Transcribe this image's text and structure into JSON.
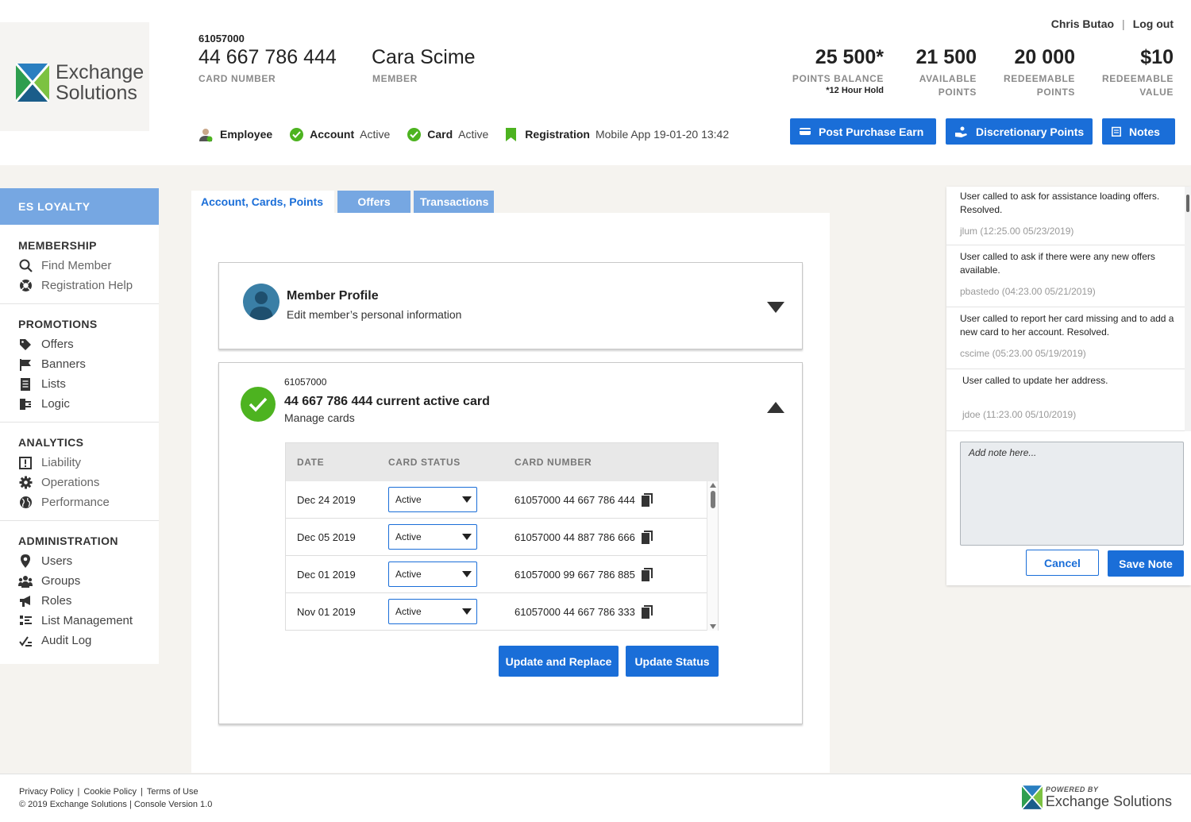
{
  "brand": {
    "line1": "Exchange",
    "line2": "Solutions"
  },
  "header": {
    "card_prefix": "61057000",
    "card_number": "44 667 786 444",
    "card_label": "CARD NUMBER",
    "member_name": "Cara Scime",
    "member_label": "MEMBER",
    "user_name": "Chris Butao",
    "separator": "|",
    "logout": "Log out",
    "stats": [
      {
        "value": "25 500*",
        "label1": "POINTS BALANCE",
        "label2": "",
        "note": "*12 Hour Hold"
      },
      {
        "value": "21 500",
        "label1": "AVAILABLE",
        "label2": "POINTS",
        "note": ""
      },
      {
        "value": "20 000",
        "label1": "REDEEMABLE",
        "label2": "POINTS",
        "note": ""
      },
      {
        "value": "$10",
        "label1": "REDEEMABLE",
        "label2": "VALUE",
        "note": ""
      }
    ],
    "statuses": {
      "employee": "Employee",
      "account_key": "Account",
      "account_val": "Active",
      "card_key": "Card",
      "card_val": "Active",
      "registration_key": "Registration",
      "registration_val": "Mobile App 19-01-20 13:42"
    },
    "buttons": {
      "post_purchase": "Post Purchase Earn",
      "discretionary": "Discretionary Points",
      "notes": "Notes"
    }
  },
  "sidebar": {
    "top": "ES LOYALTY",
    "sections": [
      {
        "title": "MEMBERSHIP",
        "items": [
          {
            "label": "Find Member",
            "icon": "search-icon"
          },
          {
            "label": "Registration Help",
            "icon": "lifebuoy-icon"
          }
        ]
      },
      {
        "title": "PROMOTIONS",
        "items": [
          {
            "label": "Offers",
            "icon": "tag-icon"
          },
          {
            "label": "Banners",
            "icon": "flag-icon"
          },
          {
            "label": "Lists",
            "icon": "list-icon"
          },
          {
            "label": "Logic",
            "icon": "logic-icon"
          }
        ]
      },
      {
        "title": "ANALYTICS",
        "items": [
          {
            "label": "Liability",
            "icon": "alert-box-icon"
          },
          {
            "label": "Operations",
            "icon": "gear-icon"
          },
          {
            "label": "Performance",
            "icon": "globe-icon"
          }
        ]
      },
      {
        "title": "ADMINISTRATION",
        "items": [
          {
            "label": "Users",
            "icon": "user-pin-icon"
          },
          {
            "label": "Groups",
            "icon": "group-icon"
          },
          {
            "label": "Roles",
            "icon": "megaphone-icon"
          },
          {
            "label": "List Management",
            "icon": "checklist-icon"
          },
          {
            "label": "Audit Log",
            "icon": "audit-icon"
          }
        ]
      }
    ]
  },
  "tabs": [
    "Account, Cards, Points",
    "Offers",
    "Transactions"
  ],
  "profile": {
    "title": "Member Profile",
    "subtitle": "Edit member’s personal information"
  },
  "cards": {
    "prefix": "61057000",
    "title": "44 667 786 444 current active card",
    "subtitle": "Manage cards",
    "columns": [
      "DATE",
      "CARD STATUS",
      "CARD NUMBER"
    ],
    "rows": [
      {
        "date": "Dec 24 2019",
        "status": "Active",
        "number": "61057000 44 667 786 444"
      },
      {
        "date": "Dec 05 2019",
        "status": "Active",
        "number": "61057000 44 887 786 666"
      },
      {
        "date": "Dec 01 2019",
        "status": "Active",
        "number": "61057000 99 667 786 885"
      },
      {
        "date": "Nov 01 2019",
        "status": "Active",
        "number": "61057000 44 667 786 333"
      }
    ],
    "update_replace": "Update and Replace",
    "update_status": "Update Status"
  },
  "notes": {
    "items": [
      {
        "text": "User called to ask for assistance loading offers. Resolved.",
        "meta": "jlum (12:25.00 05/23/2019)"
      },
      {
        "text": "User called to ask if there were any new offers available.",
        "meta": "pbastedo (04:23.00 05/21/2019)"
      },
      {
        "text": "User called to report her card missing and to add a new card to her account. Resolved.",
        "meta": "cscime (05:23.00 05/19/2019)"
      },
      {
        "text": "User called to update her address.",
        "meta": "jdoe (11:23.00 05/10/2019)"
      }
    ],
    "placeholder": "Add note here...",
    "cancel": "Cancel",
    "save": "Save Note"
  },
  "footer": {
    "privacy": "Privacy Policy",
    "cookie": "Cookie Policy",
    "terms": "Terms of Use",
    "sep": "|",
    "copyright": "© 2019 Exchange Solutions | Console Version 1.0",
    "powered_by": "POWERED BY",
    "brand": "Exchange Solutions"
  },
  "colors": {
    "primary": "#1a6ed8",
    "sidebar_top": "#76a7e2",
    "success": "#4db320",
    "registration": "#4db320"
  }
}
